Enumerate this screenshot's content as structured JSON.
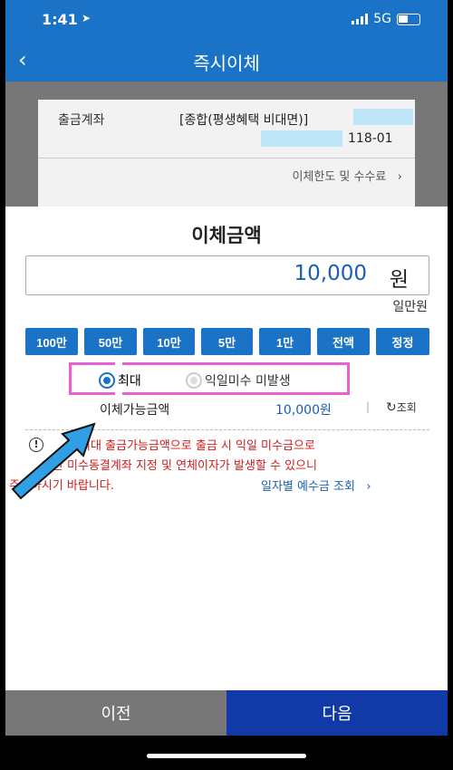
{
  "status": {
    "time": "1:41",
    "network": "5G"
  },
  "nav": {
    "title": "즉시이체"
  },
  "account": {
    "label": "출금계좌",
    "name": "[종합(평생혜택 비대면)]",
    "number_suffix": "118-01",
    "limit_link": "이체한도 및 수수료"
  },
  "transfer": {
    "title": "이체금액",
    "amount": "10,000",
    "unit": "원",
    "amount_korean": "일만원",
    "quick_buttons": [
      "100만",
      "50만",
      "10만",
      "5만",
      "1만",
      "전액",
      "정정"
    ],
    "options": {
      "max_label": "최대",
      "no_overdraft_label": "익일미수 미발생"
    },
    "available_label": "이체가능금액",
    "available_value": "10,000원",
    "refresh_label": "조회",
    "warning_line1": "최대 출금가능금액으로 출금 시 익일 미수금으로",
    "warning_line2": "인한 미수동결계좌 지정 및 연체이자가 발생할 수 있으니",
    "warning_line3": "주의하시기 바랍니다.",
    "deposit_link": "일자별 예수금 조회"
  },
  "footer": {
    "prev_label": "이전",
    "next_label": "다음"
  },
  "colors": {
    "primary": "#1a73c6",
    "next": "#1239a8",
    "prev": "#777777",
    "warning": "#d21a1a",
    "highlight": "#e85fd6"
  }
}
